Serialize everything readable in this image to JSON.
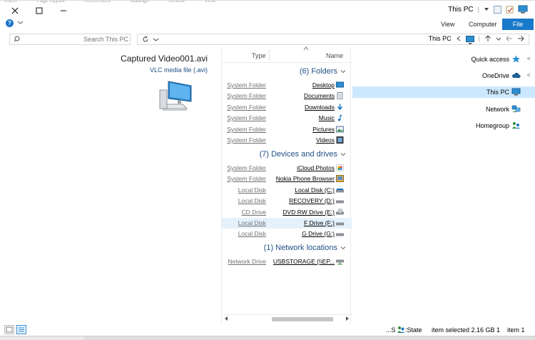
{
  "window": {
    "title": "This PC",
    "ribbon_strip_labels": [
      "Insert",
      "Page Layout",
      "References",
      "Mailings",
      "Review",
      "View"
    ]
  },
  "ribbon": {
    "tabs": [
      "View",
      "Computer",
      "File"
    ]
  },
  "address": {
    "path": "This PC"
  },
  "search": {
    "placeholder": "Search This PC"
  },
  "preview": {
    "file_name": "Captured Video001.avi",
    "file_type": "VLC media file (.avi)"
  },
  "file_list": {
    "headers": {
      "type": "Type",
      "name": "Name"
    },
    "groups": [
      {
        "label": "(6) Folders",
        "items": [
          {
            "type": "System Folder",
            "name": "Desktop",
            "icon": "desktop-folder-icon"
          },
          {
            "type": "System Folder",
            "name": "Documents",
            "icon": "documents-folder-icon"
          },
          {
            "type": "System Folder",
            "name": "Downloads",
            "icon": "downloads-folder-icon"
          },
          {
            "type": "System Folder",
            "name": "Music",
            "icon": "music-folder-icon"
          },
          {
            "type": "System Folder",
            "name": "Pictures",
            "icon": "pictures-folder-icon"
          },
          {
            "type": "System Folder",
            "name": "Videos",
            "icon": "videos-folder-icon"
          }
        ]
      },
      {
        "label": "(7) Devices and drives",
        "items": [
          {
            "type": "System Folder",
            "name": "iCloud Photos",
            "icon": "icloud-photos-icon"
          },
          {
            "type": "System Folder",
            "name": "Nokia Phone Browser",
            "icon": "phone-browser-icon"
          },
          {
            "type": "Local Disk",
            "name": "Local Disk (C:)",
            "icon": "drive-icon"
          },
          {
            "type": "Local Disk",
            "name": "RECOVERY (D:)",
            "icon": "drive-icon"
          },
          {
            "type": "CD Drive",
            "name": "DVD RW Drive (E:)",
            "icon": "dvd-drive-icon"
          },
          {
            "type": "Local Disk",
            "name": "F Drive (F:)",
            "icon": "drive-icon",
            "selected": true
          },
          {
            "type": "Local Disk",
            "name": "G Drive (G:)",
            "icon": "drive-icon"
          }
        ]
      },
      {
        "label": "(1) Network locations",
        "items": [
          {
            "type": "Network Drive",
            "name": "USBSTORAGE (\\\\EP...",
            "icon": "network-drive-icon"
          }
        ]
      }
    ]
  },
  "nav": {
    "items": [
      {
        "label": "Quick access",
        "icon": "star-icon",
        "expander": "<"
      },
      {
        "label": "OneDrive",
        "icon": "cloud-icon",
        "expander": "<"
      },
      {
        "label": "This PC",
        "icon": "computer-icon",
        "expander": "",
        "selected": true
      },
      {
        "label": "Network",
        "icon": "network-icon",
        "expander": ""
      },
      {
        "label": "Homegroup",
        "icon": "homegroup-icon",
        "expander": ""
      }
    ]
  },
  "status": {
    "state_prefix": "...S",
    "state_label": ":State",
    "selection": "item selected  2.16 GB 1",
    "count": "item 1"
  },
  "colors": {
    "accent": "#1979ca",
    "selection": "#cce8ff",
    "row_selection": "#e5f1fb",
    "group_text": "#1e4f86"
  }
}
